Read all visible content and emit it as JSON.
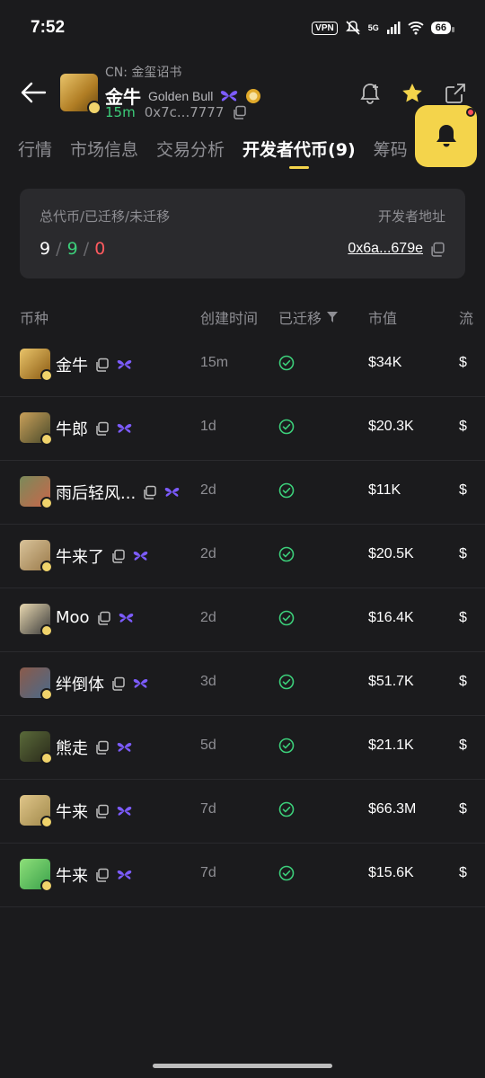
{
  "status": {
    "time": "7:52",
    "vpn": "VPN",
    "network": "5G",
    "battery": "66"
  },
  "header": {
    "cn_label": "CN: 金玺诏书",
    "name": "金牛",
    "en_name": "Golden Bull",
    "age": "15m",
    "address": "0x7c...7777"
  },
  "tabs": [
    "行情",
    "市场信息",
    "交易分析",
    "开发者代币(9)",
    "筹码"
  ],
  "active_tab": 3,
  "summary": {
    "label": "总代币/已迁移/未迁移",
    "dev_label": "开发者地址",
    "total": "9",
    "migrated": "9",
    "not_migrated": "0",
    "dev_address": "0x6a...679e"
  },
  "columns": {
    "coin": "币种",
    "created": "创建时间",
    "migrated": "已迁移",
    "mcap": "市值",
    "more": "流"
  },
  "rows": [
    {
      "name": "金牛",
      "time": "15m",
      "mcap": "$34K",
      "more": "$",
      "color1": "#e9c46a",
      "color2": "#8a5a12"
    },
    {
      "name": "牛郎",
      "time": "1d",
      "mcap": "$20.3K",
      "more": "$",
      "color1": "#c9a05a",
      "color2": "#4a4a2a"
    },
    {
      "name": "雨后轻风...",
      "time": "2d",
      "mcap": "$11K",
      "more": "$",
      "color1": "#7a8a5a",
      "color2": "#c9664a"
    },
    {
      "name": "牛来了",
      "time": "2d",
      "mcap": "$20.5K",
      "more": "$",
      "color1": "#d9c39a",
      "color2": "#9a7a4a"
    },
    {
      "name": "Moo",
      "time": "2d",
      "mcap": "$16.4K",
      "more": "$",
      "color1": "#e8d8b0",
      "color2": "#3a3a3a"
    },
    {
      "name": "绊倒体",
      "time": "3d",
      "mcap": "$51.7K",
      "more": "$",
      "color1": "#8a5a4a",
      "color2": "#4a6a8a"
    },
    {
      "name": "熊走",
      "time": "5d",
      "mcap": "$21.1K",
      "more": "$",
      "color1": "#5a6a3a",
      "color2": "#2a2a1a"
    },
    {
      "name": "牛来",
      "time": "7d",
      "mcap": "$66.3M",
      "more": "$",
      "color1": "#e0c68a",
      "color2": "#a0884a"
    },
    {
      "name": "牛来",
      "time": "7d",
      "mcap": "$15.6K",
      "more": "$",
      "color1": "#8ee07a",
      "color2": "#3aa04a"
    }
  ],
  "colors": {
    "accent": "#f4d44b",
    "green": "#3ccf7a",
    "red": "#ff5a5f",
    "purple": "#7d5cff"
  }
}
